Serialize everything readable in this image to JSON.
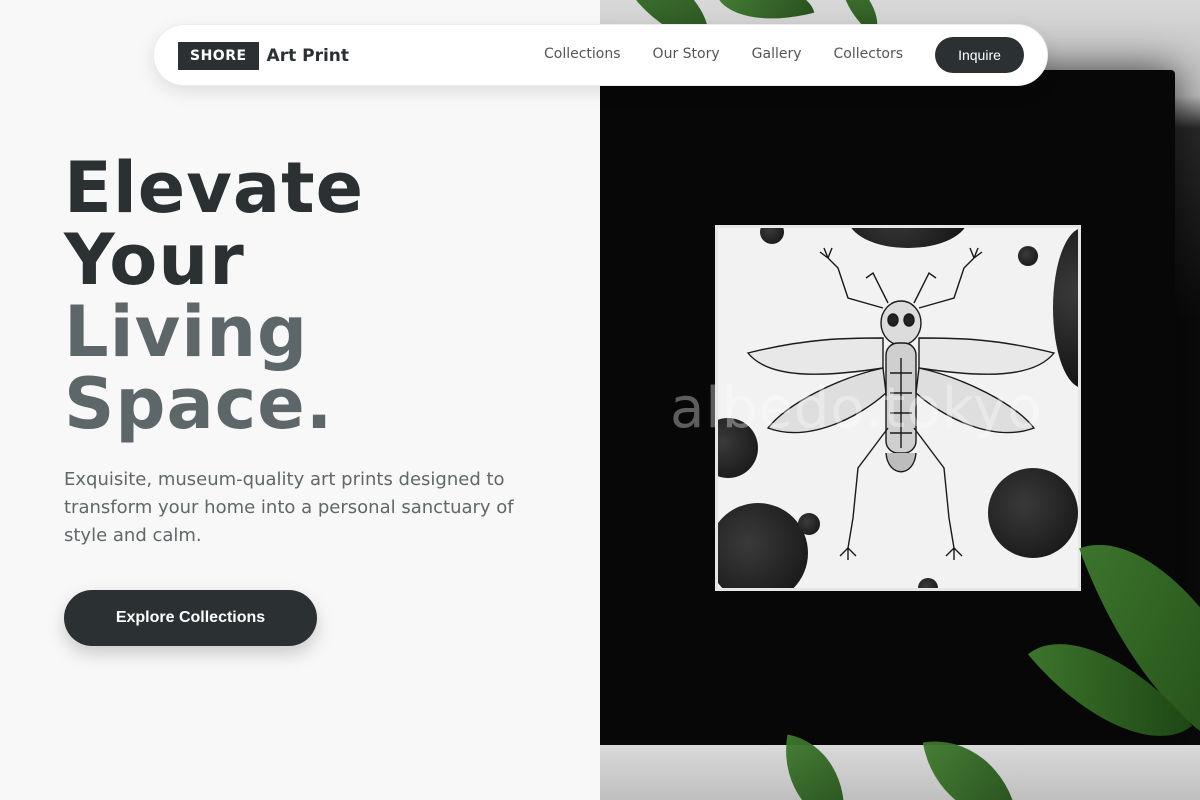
{
  "brand": {
    "badge": "SHORE",
    "name": "Art Print"
  },
  "nav": {
    "links": [
      "Collections",
      "Our Story",
      "Gallery",
      "Collectors"
    ],
    "cta_label": "Inquire"
  },
  "hero": {
    "headline": [
      "Elevate",
      "Your",
      "Living",
      "Space."
    ],
    "subtitle": "Exquisite, museum-quality art prints designed to transform your home into a personal sanctuary of style and calm.",
    "button_label": "Explore Collections"
  },
  "image": {
    "watermark": "albedo.tokyo"
  },
  "colors": {
    "accent": "#2b3133",
    "muted_heading": "#5d6668",
    "body_text": "#5f6768",
    "background": "#f8f8f8"
  }
}
